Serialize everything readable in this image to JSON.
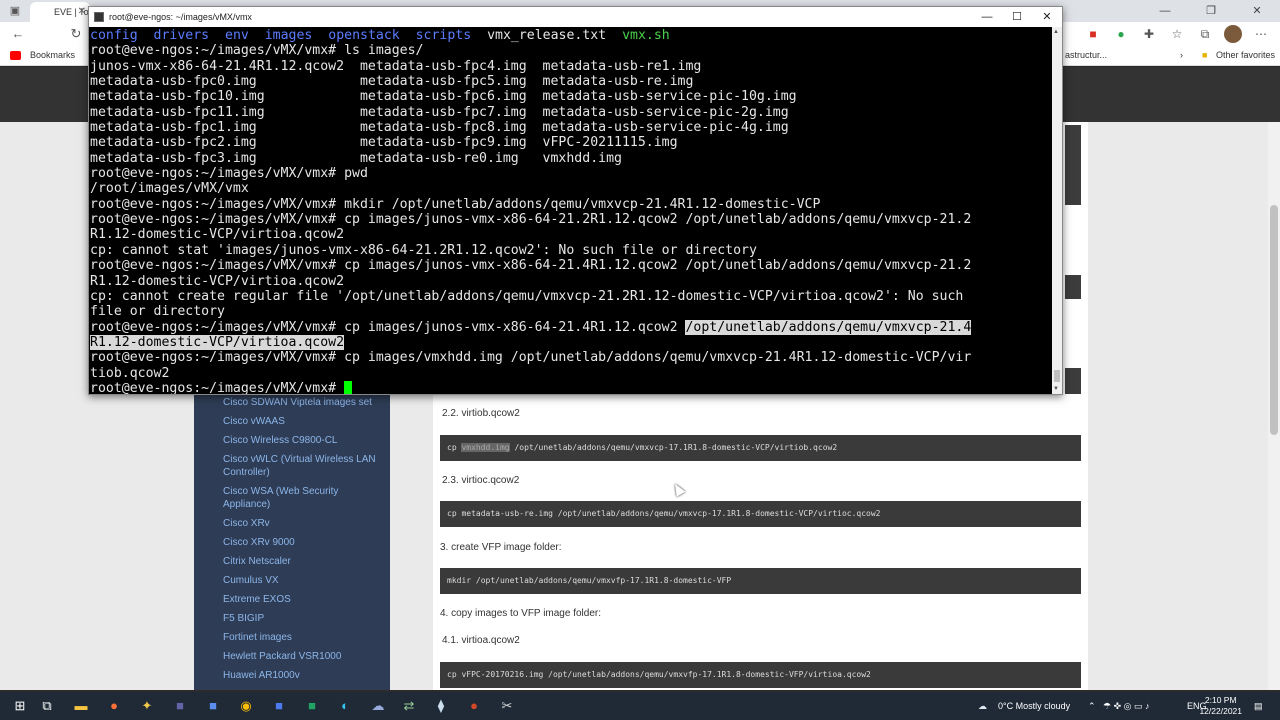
{
  "browser": {
    "tab_label": "EVE | Top",
    "bookmarks": [
      "Bookmarks",
      "astructur...",
      "Other favorites"
    ]
  },
  "sidebar": {
    "items": [
      "Cisco SDWAN Viptela images set",
      "Cisco vWAAS",
      "Cisco Wireless C9800-CL",
      "Cisco vWLC (Virtual Wireless LAN Controller)",
      "Cisco WSA (Web Security Appliance)",
      "Cisco XRv",
      "Cisco XRv 9000",
      "Citrix Netscaler",
      "Cumulus VX",
      "Extreme EXOS",
      "F5 BIGIP",
      "Fortinet images",
      "Hewlett Packard VSR1000",
      "Huawei AR1000v"
    ]
  },
  "content": {
    "h_virtiob": "2.2. virtiob.qcow2",
    "code_virtiob_hl": "vmxhdd.img",
    "code_virtiob_rest": " /opt/unetlab/addons/qemu/vmxvcp-17.1R1.8-domestic-VCP/virtiob.qcow2",
    "h_virtioc": "2.3. virtioc.qcow2",
    "code_virtioc": "cp metadata-usb-re.img /opt/unetlab/addons/qemu/vmxvcp-17.1R1.8-domestic-VCP/virtioc.qcow2",
    "h_create_vfp": "3. create VFP image folder:",
    "code_mkdir_vfp": "mkdir /opt/unetlab/addons/qemu/vmxvfp-17.1R1.8-domestic-VFP",
    "h_copy_vfp": "4. copy images to VFP image folder:",
    "h_virtioa": "4.1. virtioa.qcow2",
    "code_virtioa": "cp vFPC-20170216.img /opt/unetlab/addons/qemu/vmxvfp-17.1R1.8-domestic-VFP/virtioa.qcow2"
  },
  "terminal": {
    "title": "root@eve-ngos: ~/images/vMX/vmx",
    "ls_dirs": [
      "config",
      "drivers",
      "env",
      "images",
      "openstack",
      "scripts"
    ],
    "ls_file": "vmx_release.txt",
    "ls_exec": "vmx.sh",
    "lines": [
      "root@eve-ngos:~/images/vMX/vmx# ls images/",
      "junos-vmx-x86-64-21.4R1.12.qcow2  metadata-usb-fpc4.img  metadata-usb-re1.img",
      "metadata-usb-fpc0.img             metadata-usb-fpc5.img  metadata-usb-re.img",
      "metadata-usb-fpc10.img            metadata-usb-fpc6.img  metadata-usb-service-pic-10g.img",
      "metadata-usb-fpc11.img            metadata-usb-fpc7.img  metadata-usb-service-pic-2g.img",
      "metadata-usb-fpc1.img             metadata-usb-fpc8.img  metadata-usb-service-pic-4g.img",
      "metadata-usb-fpc2.img             metadata-usb-fpc9.img  vFPC-20211115.img",
      "metadata-usb-fpc3.img             metadata-usb-re0.img   vmxhdd.img",
      "root@eve-ngos:~/images/vMX/vmx# pwd",
      "/root/images/vMX/vmx",
      "root@eve-ngos:~/images/vMX/vmx# mkdir /opt/unetlab/addons/qemu/vmxvcp-21.4R1.12-domestic-VCP",
      "root@eve-ngos:~/images/vMX/vmx# cp images/junos-vmx-x86-64-21.2R1.12.qcow2 /opt/unetlab/addons/qemu/vmxvcp-21.2",
      "R1.12-domestic-VCP/virtioa.qcow2",
      "cp: cannot stat 'images/junos-vmx-x86-64-21.2R1.12.qcow2': No such file or directory",
      "root@eve-ngos:~/images/vMX/vmx# cp images/junos-vmx-x86-64-21.4R1.12.qcow2 /opt/unetlab/addons/qemu/vmxvcp-21.2",
      "R1.12-domestic-VCP/virtioa.qcow2",
      "cp: cannot create regular file '/opt/unetlab/addons/qemu/vmxvcp-21.2R1.12-domestic-VCP/virtioa.qcow2': No such",
      "file or directory"
    ],
    "sel_pre": "root@eve-ngos:~/images/vMX/vmx# cp images/junos-vmx-x86-64-21.4R1.12.qcow2 ",
    "sel_a": "/opt/unetlab/addons/qemu/vmxvcp-21.4",
    "sel_b": "R1.12-domestic-VCP/virtioa.qcow2",
    "line_b1": "root@eve-ngos:~/images/vMX/vmx# cp images/vmxhdd.img /opt/unetlab/addons/qemu/vmxvcp-21.4R1.12-domestic-VCP/vir",
    "line_b2": "tiob.qcow2",
    "prompt": "root@eve-ngos:~/images/vMX/vmx# "
  },
  "taskbar": {
    "weather": "0°C  Mostly cloudy",
    "lang": "ENG",
    "time": "2:10 PM",
    "date": "12/22/2021"
  }
}
